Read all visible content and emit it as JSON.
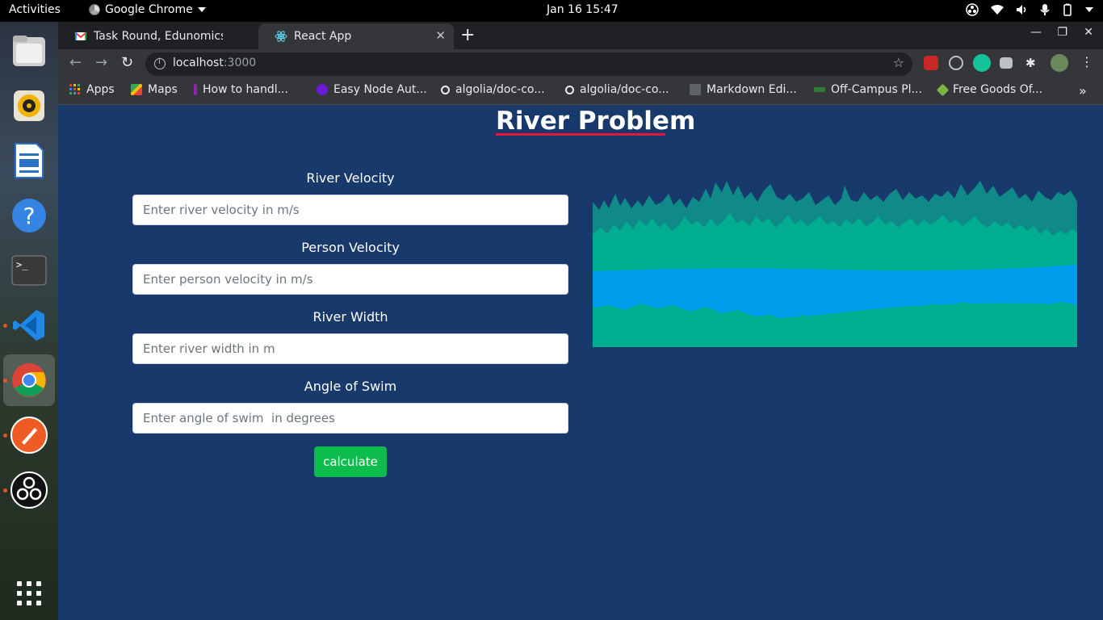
{
  "system": {
    "activities": "Activities",
    "app_name": "Google Chrome",
    "clock": "Jan 16  15:47"
  },
  "browser": {
    "tabs": [
      {
        "label": "Task Round, Edunomics Te",
        "active": false
      },
      {
        "label": "React App",
        "active": true
      }
    ],
    "url_host": "localhost",
    "url_port": ":3000",
    "bookmarks": [
      {
        "label": "Apps",
        "icon": "apps-grid-icon"
      },
      {
        "label": "Maps",
        "icon": "maps-icon"
      },
      {
        "label": "How to handl...",
        "icon": "page-icon"
      },
      {
        "label": "Easy Node Aut...",
        "icon": "page-icon"
      },
      {
        "label": "algolia/doc-co...",
        "icon": "github-icon"
      },
      {
        "label": "algolia/doc-co...",
        "icon": "github-icon"
      },
      {
        "label": "Markdown Edi...",
        "icon": "page-icon"
      },
      {
        "label": "Off-Campus Pl...",
        "icon": "page-icon"
      },
      {
        "label": "Free Goods Of...",
        "icon": "tag-icon"
      }
    ]
  },
  "page": {
    "title": "River Problem",
    "fields": [
      {
        "label": "River Velocity",
        "placeholder": "Enter river velocity in m/s"
      },
      {
        "label": "Person Velocity",
        "placeholder": "Enter person velocity in m/s"
      },
      {
        "label": "River Width",
        "placeholder": "Enter river width in m"
      },
      {
        "label": "Angle of Swim",
        "placeholder": "Enter angle of swim  in degrees"
      }
    ],
    "button": "calculate"
  },
  "colors": {
    "page_bg": "#18396b",
    "accent_underline": "#e8163d",
    "button_green": "#0cbc4c",
    "tree_dark": "#0f8a88",
    "tree_light": "#00ad8e",
    "water": "#009cec"
  }
}
